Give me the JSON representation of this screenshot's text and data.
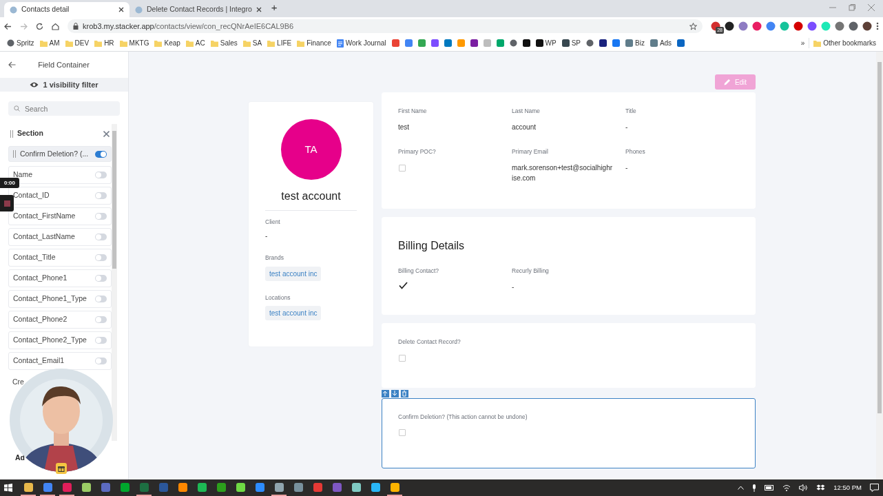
{
  "browser": {
    "tabs": [
      {
        "title": "Contacts detail",
        "selected": true
      },
      {
        "title": "Delete Contact Records | Integro",
        "selected": false
      }
    ],
    "url": {
      "host": "krob3.my.stacker.app",
      "path": "/contacts/view/con_recQNrAeIE6CAL9B6"
    },
    "extensions": [
      {
        "color": "#d32f2f",
        "badge": "28"
      },
      {
        "color": "#222222"
      },
      {
        "color": "#8e7cc3"
      },
      {
        "color": "#e91e63"
      },
      {
        "color": "#4285f4"
      },
      {
        "color": "#15c39a"
      },
      {
        "color": "#d50000"
      },
      {
        "color": "#7c4dff"
      },
      {
        "color": "#1de9b6"
      },
      {
        "color": "#757575"
      },
      {
        "color": "#5f6368"
      },
      {
        "color": "#5d4037"
      }
    ],
    "bookmarks": [
      {
        "kind": "globe",
        "label": "Spritz"
      },
      {
        "kind": "folder",
        "label": "AM"
      },
      {
        "kind": "folder",
        "label": "DEV"
      },
      {
        "kind": "folder",
        "label": "HR"
      },
      {
        "kind": "folder",
        "label": "MKTG"
      },
      {
        "kind": "folder",
        "label": "Keap"
      },
      {
        "kind": "folder",
        "label": "AC"
      },
      {
        "kind": "folder",
        "label": "Sales"
      },
      {
        "kind": "folder",
        "label": "SA"
      },
      {
        "kind": "folder",
        "label": "LIFE"
      },
      {
        "kind": "folder",
        "label": "Finance"
      },
      {
        "kind": "doc",
        "label": "Work Journal"
      },
      {
        "kind": "app",
        "color": "#ea4335"
      },
      {
        "kind": "app",
        "color": "#4285f4"
      },
      {
        "kind": "app",
        "color": "#34a853"
      },
      {
        "kind": "app",
        "color": "#7c4dff"
      },
      {
        "kind": "app",
        "color": "#0079bf"
      },
      {
        "kind": "app",
        "color": "#ff9900"
      },
      {
        "kind": "app",
        "color": "#7b1fa2"
      },
      {
        "kind": "app",
        "color": "#bdbdbd"
      },
      {
        "kind": "app",
        "color": "#00a86b"
      },
      {
        "kind": "globe"
      },
      {
        "kind": "app",
        "color": "#111111"
      },
      {
        "kind": "app",
        "color": "#111111",
        "label": "WP"
      },
      {
        "kind": "app",
        "color": "#37474f",
        "label": "SP"
      },
      {
        "kind": "globe"
      },
      {
        "kind": "app",
        "color": "#1a237e"
      },
      {
        "kind": "app",
        "color": "#1877f2"
      },
      {
        "kind": "app",
        "color": "#607d8b",
        "label": "Biz"
      },
      {
        "kind": "app",
        "color": "#607d8b",
        "label": "Ads"
      },
      {
        "kind": "app",
        "color": "#0a66c2"
      }
    ],
    "new_tab": "+",
    "overflow": "»",
    "other_bookmarks": "Other bookmarks"
  },
  "sidebar": {
    "title": "Field Container",
    "filter": "1 visibility filter",
    "search_placeholder": "Search",
    "section": "Section",
    "items": [
      {
        "label": "Confirm Deletion? (...",
        "on": true,
        "selected": true
      },
      {
        "label": "Name",
        "on": false,
        "selected": false
      },
      {
        "label": "Contact_ID",
        "on": false,
        "selected": false
      },
      {
        "label": "Contact_FirstName",
        "on": false,
        "selected": false
      },
      {
        "label": "Contact_LastName",
        "on": false,
        "selected": false
      },
      {
        "label": "Contact_Title",
        "on": false,
        "selected": false
      },
      {
        "label": "Contact_Phone1",
        "on": false,
        "selected": false
      },
      {
        "label": "Contact_Phone1_Type",
        "on": false,
        "selected": false
      },
      {
        "label": "Contact_Phone2",
        "on": false,
        "selected": false
      },
      {
        "label": "Contact_Phone2_Type",
        "on": false,
        "selected": false
      },
      {
        "label": "Contact_Email1",
        "on": false,
        "selected": false
      },
      {
        "label": "Cre",
        "kind": "partial"
      }
    ],
    "add_button": "Ad"
  },
  "recorder": {
    "time": "0:00"
  },
  "edit_button": "Edit",
  "profile": {
    "initials": "TA",
    "name": "test account",
    "fields": [
      {
        "label": "Client",
        "kind": "text",
        "value": "-"
      },
      {
        "label": "Brands",
        "kind": "tag",
        "value": "test account inc"
      },
      {
        "label": "Locations",
        "kind": "tag",
        "value": "test account inc"
      }
    ]
  },
  "cards": [
    {
      "selected": false,
      "fields": [
        {
          "label": "First Name",
          "kind": "text",
          "value": "test"
        },
        {
          "label": "Last Name",
          "kind": "text",
          "value": "account"
        },
        {
          "label": "Title",
          "kind": "text",
          "value": "-"
        },
        {
          "label": "Primary POC?",
          "kind": "checkbox",
          "checked": false
        },
        {
          "label": "Primary Email",
          "kind": "text",
          "value": "mark.sorenson+test@socialhighrise.com"
        },
        {
          "label": "Phones",
          "kind": "text",
          "value": "-"
        }
      ]
    },
    {
      "title": "Billing Details",
      "selected": false,
      "fields": [
        {
          "label": "Billing Contact?",
          "kind": "checkbox",
          "checked": true
        },
        {
          "label": "Recurly Billing",
          "kind": "text",
          "value": "-"
        }
      ]
    },
    {
      "selected": false,
      "fields": [
        {
          "label": "Delete Contact Record?",
          "kind": "checkbox",
          "checked": false
        }
      ]
    },
    {
      "selected": true,
      "fields": [
        {
          "label": "Confirm Deletion? (This action cannot be undone)",
          "kind": "checkbox",
          "checked": false
        }
      ]
    }
  ],
  "taskbar": {
    "apps": [
      {
        "color": "#e8b84a",
        "running": true
      },
      {
        "color": "#4285f4",
        "running": true
      },
      {
        "color": "#e01e5a",
        "running": true
      },
      {
        "color": "#9ccc65",
        "running": false
      },
      {
        "color": "#5c6bc0",
        "running": false
      },
      {
        "color": "#00a82d",
        "running": false
      },
      {
        "color": "#1d6f42",
        "running": true
      },
      {
        "color": "#2b579a",
        "running": false
      },
      {
        "color": "#ff8800",
        "running": false
      },
      {
        "color": "#1db954",
        "running": false
      },
      {
        "color": "#2ca01c",
        "running": false
      },
      {
        "color": "#6fda44",
        "running": false
      },
      {
        "color": "#2d8cff",
        "running": false
      },
      {
        "color": "#90a4ae",
        "running": true
      },
      {
        "color": "#78909c",
        "running": false
      },
      {
        "color": "#e53935",
        "running": false
      },
      {
        "color": "#7e57c2",
        "running": false
      },
      {
        "color": "#80cbc4",
        "running": false
      },
      {
        "color": "#29b6f6",
        "running": false
      },
      {
        "color": "#fcb400",
        "running": true
      }
    ],
    "time": "12:50 PM"
  }
}
